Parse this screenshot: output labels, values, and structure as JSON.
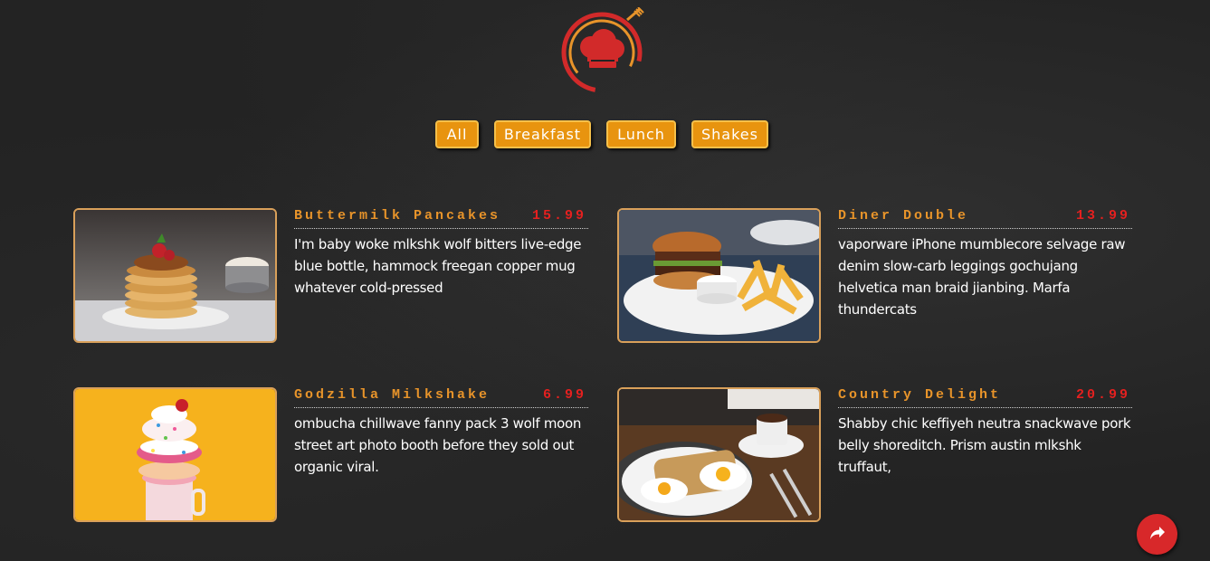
{
  "brand": {
    "logo_icon": "chef-hat-fork-icon",
    "accent": "#e8940f",
    "price_color": "#e5201f",
    "name_color": "#e8942a"
  },
  "filters": [
    {
      "label": "All"
    },
    {
      "label": "Breakfast"
    },
    {
      "label": "Lunch"
    },
    {
      "label": "Shakes"
    }
  ],
  "menu": [
    {
      "name": "Buttermilk Pancakes",
      "price": "15.99",
      "description": "I'm baby woke mlkshk wolf bitters live-edge blue bottle, hammock freegan copper mug whatever cold-pressed",
      "image_icon": "pancakes-photo"
    },
    {
      "name": "Diner Double",
      "price": "13.99",
      "description": "vaporware iPhone mumblecore selvage raw denim slow-carb leggings gochujang helvetica man braid jianbing. Marfa thundercats",
      "image_icon": "burger-fries-photo"
    },
    {
      "name": "Godzilla Milkshake",
      "price": "6.99",
      "description": "ombucha chillwave fanny pack 3 wolf moon street art photo booth before they sold out organic viral.",
      "image_icon": "milkshake-photo"
    },
    {
      "name": "Country Delight",
      "price": "20.99",
      "description": "Shabby chic keffiyeh neutra snackwave pork belly shoreditch. Prism austin mlkshk truffaut,",
      "image_icon": "eggs-toast-photo"
    }
  ],
  "fab": {
    "icon": "share-arrow-icon"
  }
}
